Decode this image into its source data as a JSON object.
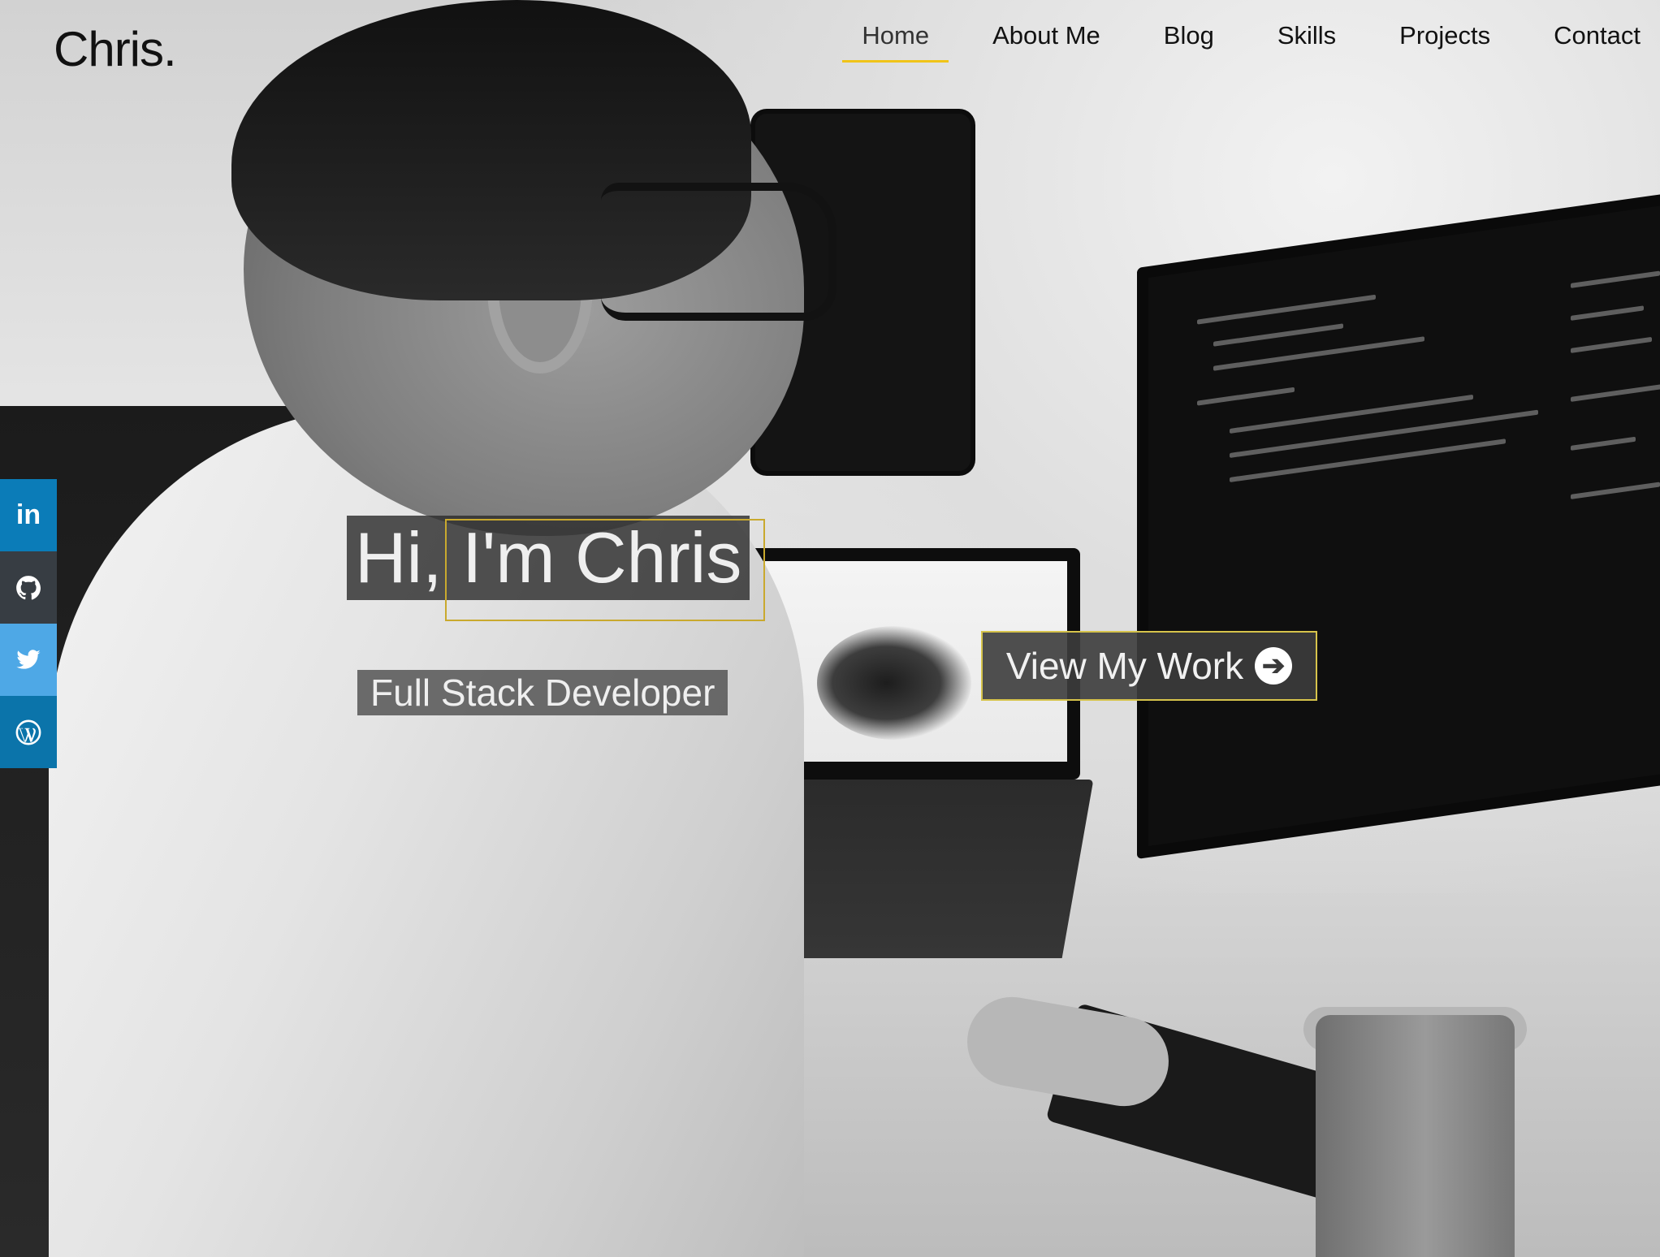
{
  "header": {
    "logo": "Chris.",
    "nav": [
      {
        "label": "Home",
        "active": true
      },
      {
        "label": "About Me",
        "active": false
      },
      {
        "label": "Blog",
        "active": false
      },
      {
        "label": "Skills",
        "active": false
      },
      {
        "label": "Projects",
        "active": false
      },
      {
        "label": "Contact",
        "active": false
      }
    ],
    "accent_color": "#f0c419"
  },
  "social": [
    {
      "icon": "linkedin-icon",
      "glyph": "in",
      "color": "#0b7cb8"
    },
    {
      "icon": "github-icon",
      "glyph": "",
      "color": "#373d43"
    },
    {
      "icon": "twitter-icon",
      "glyph": "",
      "color": "#4ea8e6"
    },
    {
      "icon": "wordpress-icon",
      "glyph": "",
      "color": "#0b74aa"
    }
  ],
  "hero": {
    "title": "Hi, I'm Chris",
    "subtitle": "Full Stack Developer",
    "cta_label": "View My Work",
    "cta_icon": "arrow-circle-right-icon"
  }
}
